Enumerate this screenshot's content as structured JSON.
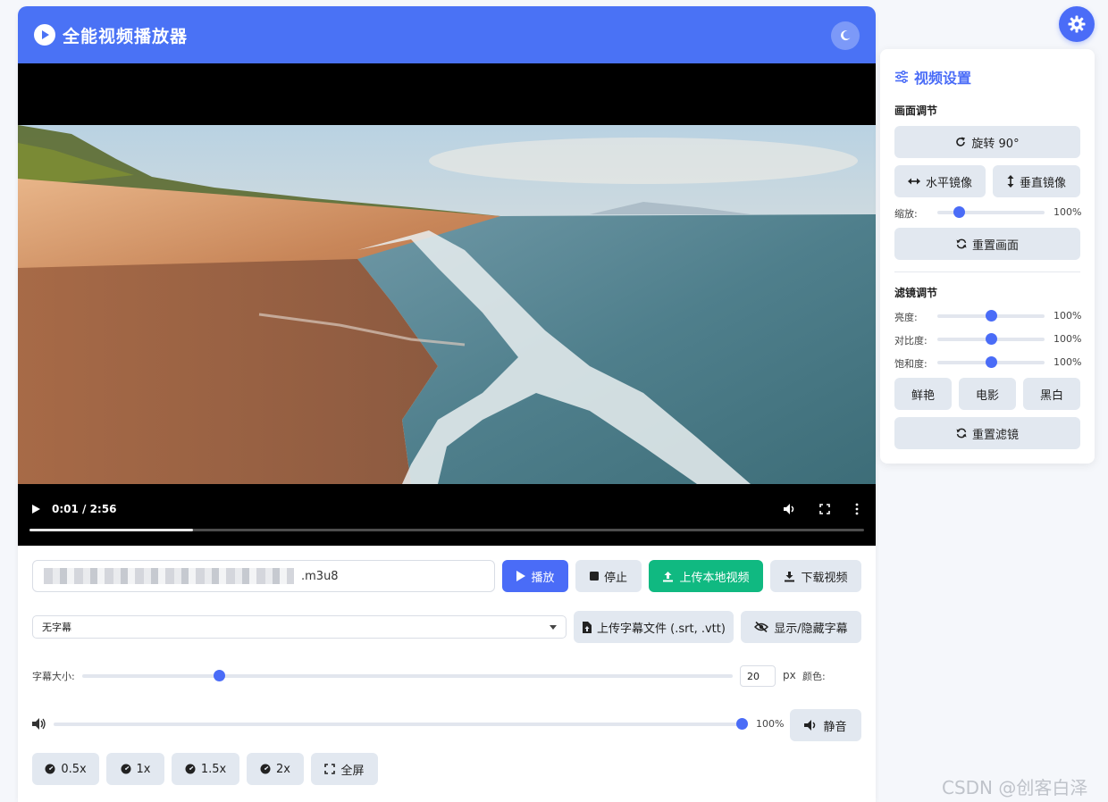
{
  "header": {
    "title": "全能视频播放器"
  },
  "player": {
    "time": "0:01 / 2:56",
    "progress": 0.196
  },
  "controls": {
    "url_suffix": ".m3u8",
    "play_label": "播放",
    "stop_label": "停止",
    "upload_video_label": "上传本地视频",
    "download_label": "下载视频",
    "subtitle_select_value": "无字幕",
    "upload_subtitle_label": "上传字幕文件 (.srt, .vtt)",
    "toggle_subtitle_label": "显示/隐藏字幕",
    "font_size_label": "字幕大小:",
    "font_size_value": "20",
    "font_size_unit": "px",
    "color_label": "颜色:",
    "font_size_slider": 0.21,
    "volume_slider": 1.0,
    "volume_value": "100%",
    "mute_label": "静音",
    "speeds": [
      "0.5x",
      "1x",
      "1.5x",
      "2x"
    ],
    "fullscreen_label": "全屏"
  },
  "settings": {
    "title": "视频设置",
    "picture_section": "画面调节",
    "rotate_label": "旋转 90°",
    "hflip_label": "水平镜像",
    "vflip_label": "垂直镜像",
    "zoom_label": "缩放:",
    "zoom_value": "100%",
    "zoom_slider": 0.2,
    "reset_picture_label": "重置画面",
    "filter_section": "滤镜调节",
    "brightness_label": "亮度:",
    "brightness_value": "100%",
    "brightness_slider": 0.5,
    "contrast_label": "对比度:",
    "contrast_value": "100%",
    "contrast_slider": 0.5,
    "saturation_label": "饱和度:",
    "saturation_value": "100%",
    "saturation_slider": 0.5,
    "presets": [
      "鲜艳",
      "电影",
      "黑白"
    ],
    "reset_filter_label": "重置滤镜"
  },
  "watermark": "CSDN @创客白泽",
  "colors": {
    "accent": "#4a6cf7",
    "header": "#4a72f5",
    "green": "#10b981",
    "button_gray": "#e2e8f0"
  }
}
